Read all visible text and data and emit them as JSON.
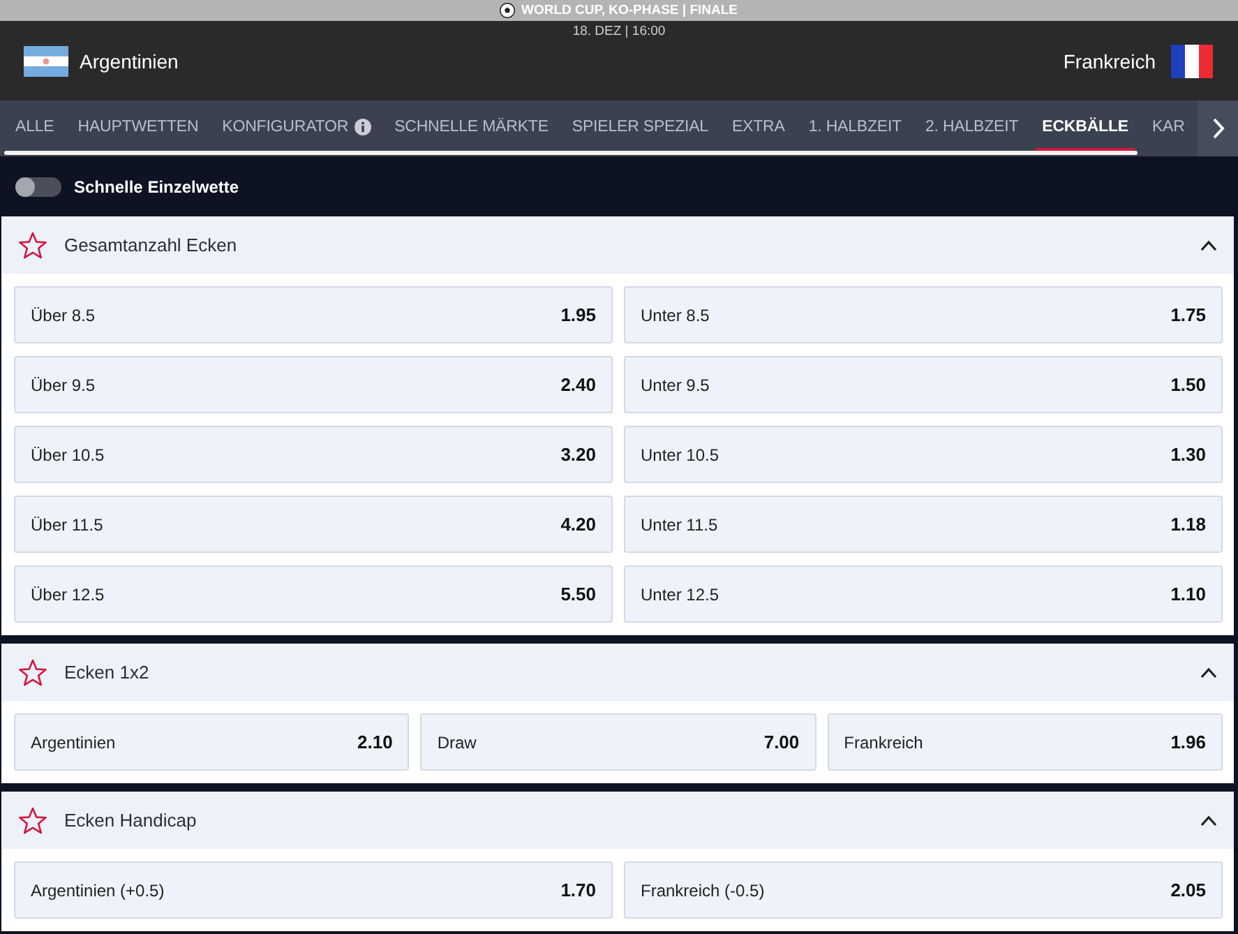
{
  "competition_bar": {
    "title": "WORLD CUP, KO-PHASE | FINALE"
  },
  "match": {
    "datetime": "18. DEZ | 16:00",
    "home": "Argentinien",
    "away": "Frankreich"
  },
  "tabs": [
    {
      "label": "ALLE",
      "selected": false,
      "info": false
    },
    {
      "label": "HAUPTWETTEN",
      "selected": false,
      "info": false
    },
    {
      "label": "KONFIGURATOR",
      "selected": false,
      "info": true
    },
    {
      "label": "SCHNELLE MÄRKTE",
      "selected": false,
      "info": false
    },
    {
      "label": "SPIELER SPEZIAL",
      "selected": false,
      "info": false
    },
    {
      "label": "EXTRA",
      "selected": false,
      "info": false
    },
    {
      "label": "1. HALBZEIT",
      "selected": false,
      "info": false
    },
    {
      "label": "2. HALBZEIT",
      "selected": false,
      "info": false
    },
    {
      "label": "ECKBÄLLE",
      "selected": true,
      "info": false
    },
    {
      "label": "KAR",
      "selected": false,
      "info": false
    }
  ],
  "quick_bet": {
    "label": "Schnelle Einzelwette",
    "on": false
  },
  "markets": [
    {
      "title": "Gesamtanzahl Ecken",
      "favorite": false,
      "expanded": true,
      "outcomes": [
        {
          "label": "Über 8.5",
          "odds": "1.95"
        },
        {
          "label": "Unter 8.5",
          "odds": "1.75"
        },
        {
          "label": "Über 9.5",
          "odds": "2.40"
        },
        {
          "label": "Unter 9.5",
          "odds": "1.50"
        },
        {
          "label": "Über 10.5",
          "odds": "3.20"
        },
        {
          "label": "Unter 10.5",
          "odds": "1.30"
        },
        {
          "label": "Über 11.5",
          "odds": "4.20"
        },
        {
          "label": "Unter 11.5",
          "odds": "1.18"
        },
        {
          "label": "Über 12.5",
          "odds": "5.50"
        },
        {
          "label": "Unter 12.5",
          "odds": "1.10"
        }
      ]
    },
    {
      "title": "Ecken 1x2",
      "favorite": false,
      "expanded": true,
      "outcomes": [
        {
          "label": "Argentinien",
          "odds": "2.10"
        },
        {
          "label": "Draw",
          "odds": "7.00"
        },
        {
          "label": "Frankreich",
          "odds": "1.96"
        }
      ]
    },
    {
      "title": "Ecken Handicap",
      "favorite": false,
      "expanded": true,
      "outcomes": [
        {
          "label": "Argentinien (+0.5)",
          "odds": "1.70"
        },
        {
          "label": "Frankreich (-0.5)",
          "odds": "2.05"
        }
      ]
    }
  ]
}
